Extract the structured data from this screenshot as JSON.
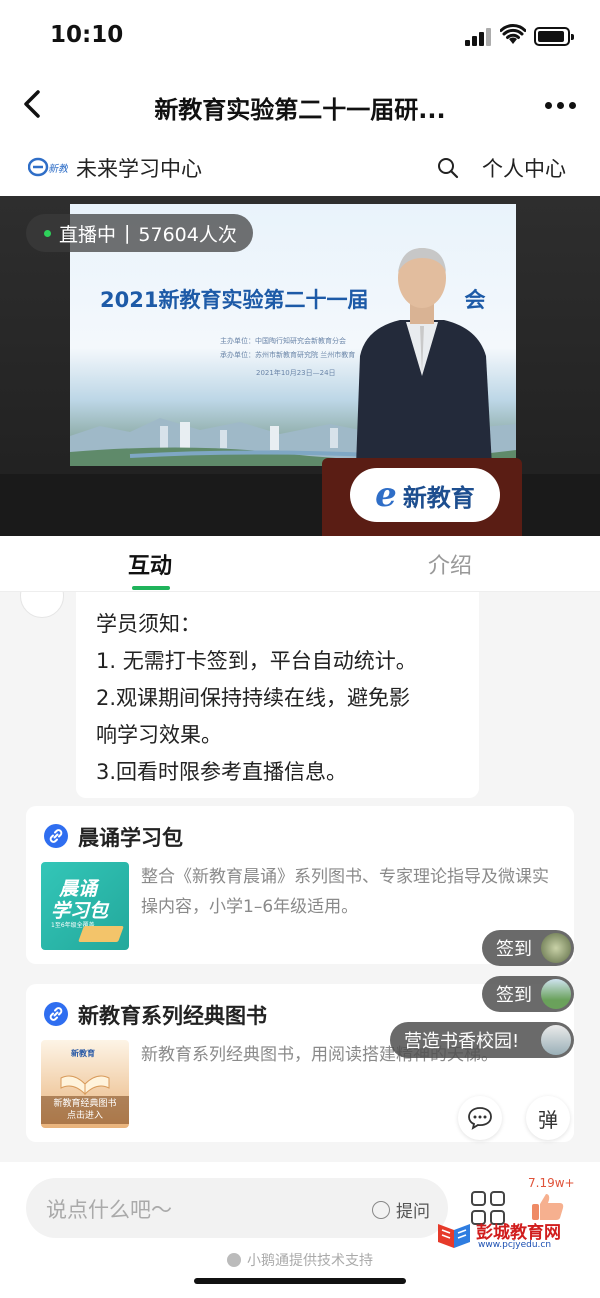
{
  "status_bar": {
    "time": "10:10"
  },
  "nav": {
    "title": "新教育实验第二十一届研..."
  },
  "org": {
    "logo_text": "新教育",
    "name": "未来学习中心",
    "personal_center": "个人中心"
  },
  "video": {
    "live_label": "直播中",
    "viewer_count": "57604人次",
    "slide_title": "2021新教育实验第二十一届",
    "slide_title_tail": "会",
    "slide_line1": "主办单位：中国陶行知研究会新教育分会",
    "slide_line2": "承办单位：苏州市新教育研究院  兰州市教育",
    "slide_line3": "2021年10月23日—24日",
    "podium_text": "新教育"
  },
  "tabs": [
    {
      "label": "互动"
    },
    {
      "label": "介绍"
    }
  ],
  "notice": {
    "lines": [
      "学员须知：",
      "1. 无需打卡签到，平台自动统计。",
      "2.观课期间保持持续在线，避免影",
      "响学习效果。",
      "3.回看时限参考直播信息。"
    ]
  },
  "cards": [
    {
      "title": "晨诵学习包",
      "description": "整合《新教育晨诵》系列图书、专家理论指导及微课实操内容，小学1–6年级适用。",
      "thumb_line1": "晨诵",
      "thumb_line2": "学习包",
      "thumb_line3": "1至6年级全覆盖"
    },
    {
      "title": "新教育系列经典图书",
      "description": "新教育系列经典图书，用阅读搭建精神的天梯。",
      "thumb_brand": "新教育",
      "thumb_label": "新教育经典图书\n点击进入"
    }
  ],
  "floating": {
    "signin1": "签到",
    "signin2": "签到",
    "message": "营造书香校园!",
    "barrage_label": "弹"
  },
  "bottom": {
    "input_placeholder": "说点什么吧～",
    "ask_label": "提问",
    "like_count": "7.19w+",
    "powered_by": "小鹅通提供技术支持",
    "watermark_name": "彭城教育网",
    "watermark_url": "www.pcjyedu.cn"
  },
  "colors": {
    "accent_green": "#1fb35b",
    "link_blue": "#2f6ef0",
    "live_dot": "#2ed15a"
  }
}
